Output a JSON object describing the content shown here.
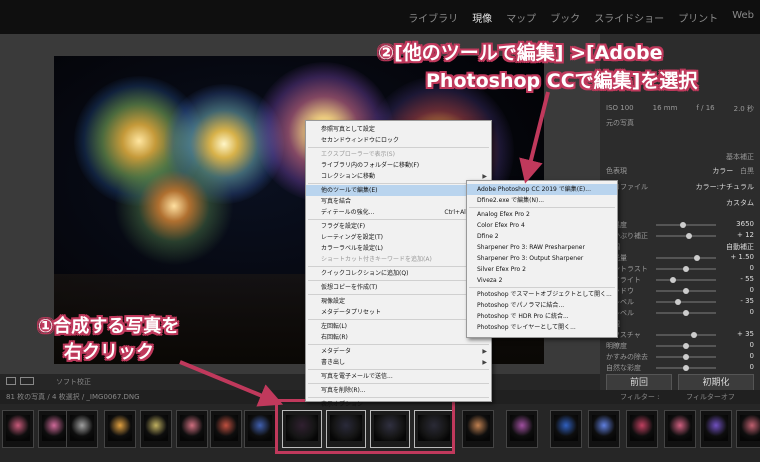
{
  "modules": [
    "ライブラリ",
    "現像",
    "マップ",
    "ブック",
    "スライドショー",
    "プリント",
    "Web"
  ],
  "active_module": "現像",
  "right_panel": {
    "exif": [
      "ISO 100",
      "16 mm",
      "f / 16",
      "2.0 秒"
    ],
    "original_label": "元の写真",
    "basic_label": "基本補正",
    "treatment_label": "色表現",
    "color_option": "カラー",
    "bw_option": "白黒",
    "profile_label": "プロファイル",
    "profile_value": "カラー:ナチュラル",
    "wb_label": "WB",
    "wb_value": "カスタム",
    "sliders": [
      {
        "label": "色温度",
        "value": "3650",
        "pos": 0.45
      },
      {
        "label": "色かぶり補正",
        "value": "+ 12",
        "pos": 0.55
      },
      {
        "label": "階調",
        "value": "自動補正",
        "pos": null
      },
      {
        "label": "露光量",
        "value": "+ 1.50",
        "pos": 0.7
      },
      {
        "label": "コントラスト",
        "value": "0",
        "pos": 0.5
      },
      {
        "label": "ハイライト",
        "value": "- 55",
        "pos": 0.25
      },
      {
        "label": "シャドウ",
        "value": "0",
        "pos": 0.5
      },
      {
        "label": "白レベル",
        "value": "- 35",
        "pos": 0.35
      },
      {
        "label": "黒レベル",
        "value": "0",
        "pos": 0.5
      },
      {
        "label": "外観",
        "value": "",
        "pos": null
      },
      {
        "label": "テクスチャ",
        "value": "+ 35",
        "pos": 0.65
      },
      {
        "label": "明瞭度",
        "value": "0",
        "pos": 0.5
      },
      {
        "label": "かすみの除去",
        "value": "0",
        "pos": 0.5
      },
      {
        "label": "自然な彩度",
        "value": "0",
        "pos": 0.5
      }
    ],
    "prev_button": "前回",
    "reset_button": "初期化"
  },
  "toolbar": {
    "softproof": "ソフト校正"
  },
  "filmstrip_bar": {
    "info": "81 枚の写真 / 4 枚選択 / _IMG0067.DNG",
    "filter_label": "フィルター :",
    "filter_value": "フィルターオフ"
  },
  "context_menu": [
    {
      "label": "参照写真として設定",
      "disabled": false,
      "arrow": false,
      "shortcut": ""
    },
    {
      "label": "セカンドウィンドウにロック",
      "disabled": false,
      "arrow": false,
      "shortcut": ""
    },
    {
      "sep": true
    },
    {
      "label": "エクスプローラーで表示(S)",
      "disabled": true,
      "arrow": false,
      "shortcut": ""
    },
    {
      "label": "ライブラリ内のフォルダーに移動(F)",
      "disabled": false,
      "arrow": false,
      "shortcut": ""
    },
    {
      "label": "コレクションに移動",
      "disabled": false,
      "arrow": true,
      "shortcut": ""
    },
    {
      "sep": true
    },
    {
      "label": "他のツールで編集(E)",
      "disabled": false,
      "arrow": true,
      "shortcut": "",
      "highlight": true
    },
    {
      "label": "写真を結合",
      "disabled": false,
      "arrow": true,
      "shortcut": ""
    },
    {
      "label": "ディテールの強化...",
      "disabled": false,
      "arrow": false,
      "shortcut": "Ctrl+Alt+I"
    },
    {
      "sep": true
    },
    {
      "label": "フラグを設定(F)",
      "disabled": false,
      "arrow": true,
      "shortcut": ""
    },
    {
      "label": "レーティングを設定(T)",
      "disabled": false,
      "arrow": true,
      "shortcut": ""
    },
    {
      "label": "カラーラベルを設定(L)",
      "disabled": false,
      "arrow": true,
      "shortcut": ""
    },
    {
      "label": "ショートカット付きキーワードを追加(A)",
      "disabled": true,
      "arrow": false,
      "shortcut": ""
    },
    {
      "sep": true
    },
    {
      "label": "クイックコレクションに追加(Q)",
      "disabled": false,
      "arrow": false,
      "shortcut": ""
    },
    {
      "sep": true
    },
    {
      "label": "仮想コピーを作成(T)",
      "disabled": false,
      "arrow": false,
      "shortcut": ""
    },
    {
      "sep": true
    },
    {
      "label": "現像設定",
      "disabled": false,
      "arrow": true,
      "shortcut": ""
    },
    {
      "label": "メタデータプリセット",
      "disabled": false,
      "arrow": true,
      "shortcut": ""
    },
    {
      "sep": true
    },
    {
      "label": "左回転(L)",
      "disabled": false,
      "arrow": false,
      "shortcut": ""
    },
    {
      "label": "右回転(R)",
      "disabled": false,
      "arrow": false,
      "shortcut": ""
    },
    {
      "sep": true
    },
    {
      "label": "メタデータ",
      "disabled": false,
      "arrow": true,
      "shortcut": ""
    },
    {
      "label": "書き出し",
      "disabled": false,
      "arrow": true,
      "shortcut": ""
    },
    {
      "sep": true
    },
    {
      "label": "写真を電子メールで送信...",
      "disabled": false,
      "arrow": false,
      "shortcut": ""
    },
    {
      "sep": true
    },
    {
      "label": "写真を削除(R)...",
      "disabled": false,
      "arrow": false,
      "shortcut": ""
    },
    {
      "sep": true
    },
    {
      "label": "表示オプション",
      "disabled": false,
      "arrow": false,
      "shortcut": ""
    }
  ],
  "submenu": [
    {
      "label": "Adobe Photoshop CC 2019 で編集(E)...",
      "highlight": true
    },
    {
      "label": "Dfine2.exe で編集(N)..."
    },
    {
      "sep": true
    },
    {
      "label": "Analog Efex Pro 2"
    },
    {
      "label": "Color Efex Pro 4"
    },
    {
      "label": "Dfine 2"
    },
    {
      "label": "Sharpener Pro 3: RAW Presharpener"
    },
    {
      "label": "Sharpener Pro 3: Output Sharpener"
    },
    {
      "label": "Silver Efex Pro 2"
    },
    {
      "label": "Viveza 2"
    },
    {
      "sep": true
    },
    {
      "label": "Photoshop でスマートオブジェクトとして開く..."
    },
    {
      "label": "Photoshop でパノラマに結合..."
    },
    {
      "label": "Photoshop で HDR Pro に統合..."
    },
    {
      "label": "Photoshop でレイヤーとして開く..."
    }
  ],
  "annotations": {
    "step2_line1": "②[他のツールで編集] >[Adobe",
    "step2_line2": "Photoshop CCで編集]を選択",
    "step1_line1": "①合成する写真を",
    "step1_line2": "右クリック"
  },
  "colors": {
    "accent": "#c0395c",
    "menu_highlight": "#b9d4ee"
  }
}
